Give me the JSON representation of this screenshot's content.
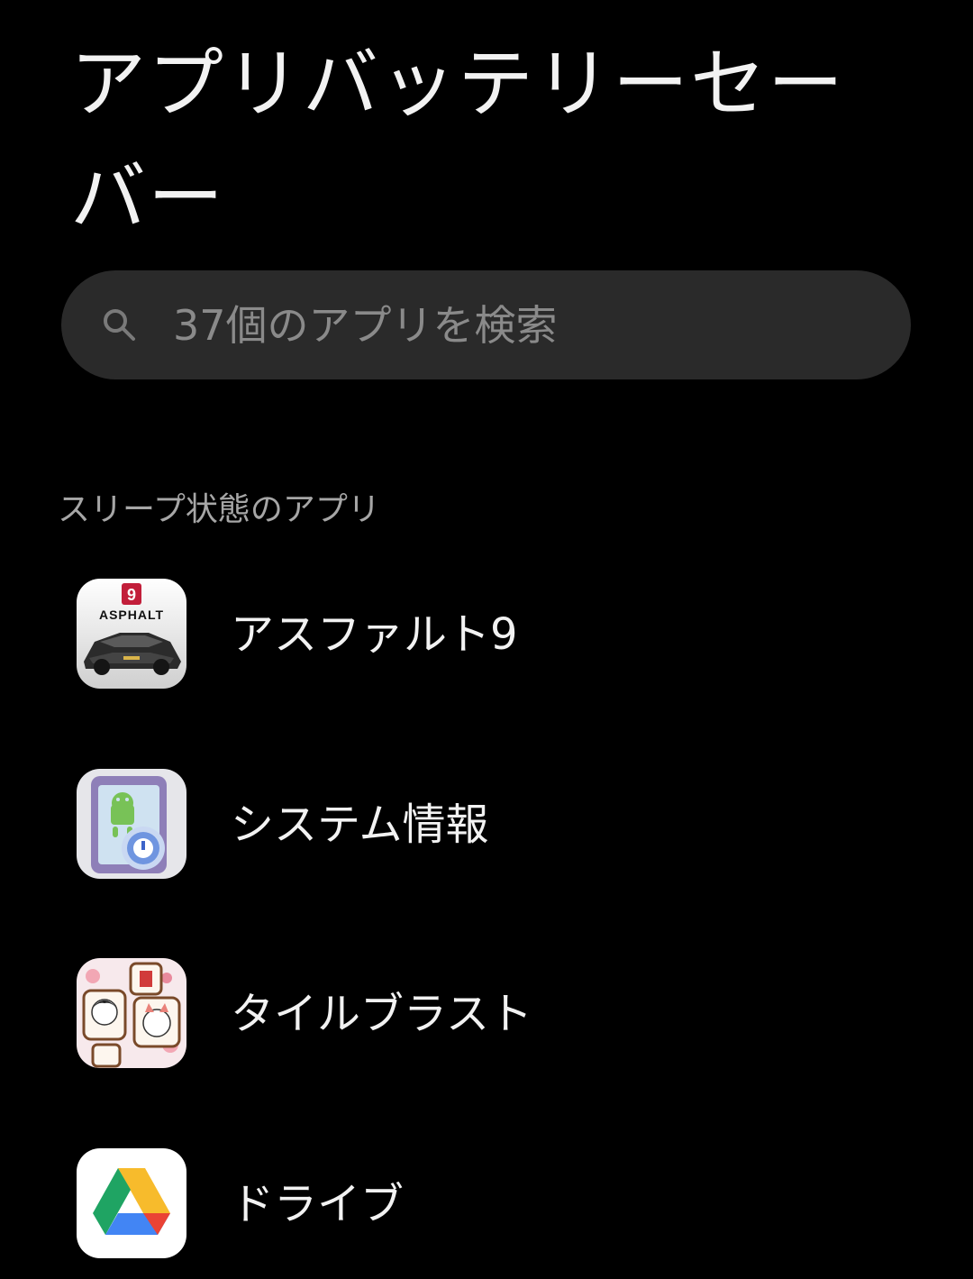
{
  "header": {
    "title": "アプリバッテリーセーバー"
  },
  "search": {
    "placeholder": "37個のアプリを検索",
    "value": ""
  },
  "section": {
    "title": "スリープ状態のアプリ"
  },
  "apps": [
    {
      "label": "アスファルト9",
      "icon": "asphalt-9-icon",
      "icon_text": "ASPHALT",
      "icon_badge": "9"
    },
    {
      "label": "システム情報",
      "icon": "system-info-icon"
    },
    {
      "label": "タイルブラスト",
      "icon": "tile-blast-icon"
    },
    {
      "label": "ドライブ",
      "icon": "google-drive-icon"
    }
  ],
  "colors": {
    "background": "#000000",
    "search_background": "#2a2a2a",
    "title_text": "#f2f2f2",
    "secondary_text": "#a6a6a6",
    "placeholder_text": "#8a8a8a"
  }
}
